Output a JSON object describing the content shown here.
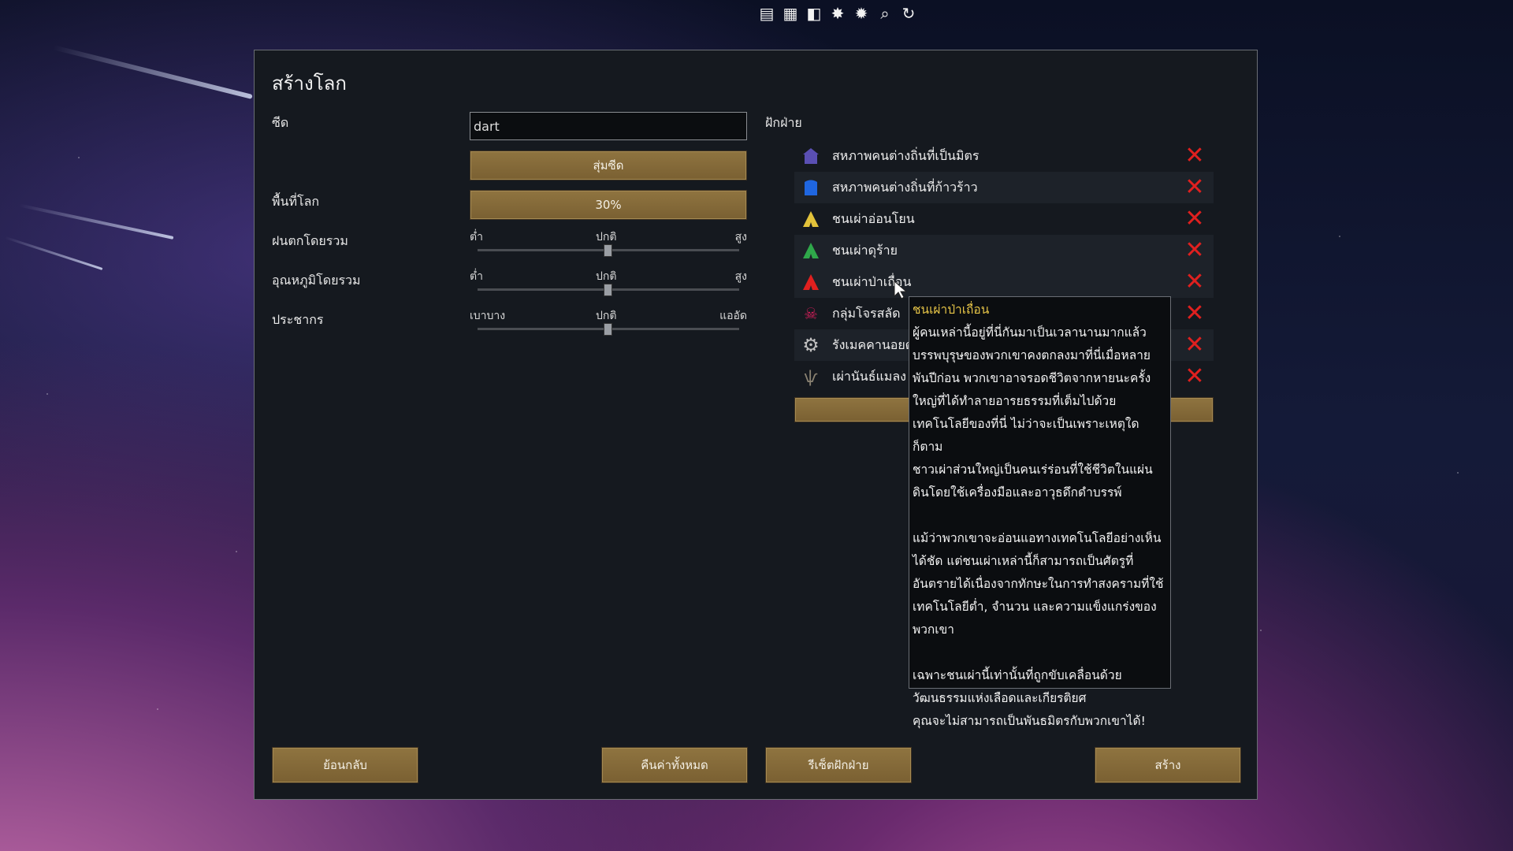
{
  "toolbar": {
    "icons": [
      "list-icon",
      "table-icon",
      "stack-icon",
      "spark-icon",
      "spark-alt-icon",
      "search-icon",
      "refresh-icon"
    ]
  },
  "dialog": {
    "title": "สร้างโลก",
    "seed_label": "ซีด",
    "seed_value": "dart",
    "random_seed_button": "สุ่มซีด",
    "coverage_label": "พื้นที่โลก",
    "coverage_value": "30%",
    "rainfall_label": "ฝนตกโดยรวม",
    "temperature_label": "อุณหภูมิโดยรวม",
    "population_label": "ประชากร",
    "rainfall": {
      "low": "ต่ำ",
      "mid": "ปกติ",
      "high": "สูง"
    },
    "temperature": {
      "low": "ต่ำ",
      "mid": "ปกติ",
      "high": "สูง"
    },
    "population": {
      "low": "เบาบาง",
      "mid": "ปกติ",
      "high": "แออัด"
    }
  },
  "factions": {
    "title": "ฝักฝ่าย",
    "items": [
      {
        "name": "สหภาพคนต่างถิ่นที่เป็นมิตร",
        "icon": "house-icon",
        "color": "#5a4fb3"
      },
      {
        "name": "สหภาพคนต่างถิ่นที่ก้าวร้าว",
        "icon": "house-icon",
        "color": "#1f66e0"
      },
      {
        "name": "ชนเผ่าอ่อนโยน",
        "icon": "tribe-tent-icon",
        "color": "#e2c23a"
      },
      {
        "name": "ชนเผ่าดุร้าย",
        "icon": "tribe-tent-icon",
        "color": "#2fa84a"
      },
      {
        "name": "ชนเผ่าป่าเถื่อน",
        "icon": "tribe-tent-icon",
        "color": "#e0201f"
      },
      {
        "name": "กลุ่มโจรสลัด",
        "icon": "skull-icon",
        "color": "#d21f5a"
      },
      {
        "name": "รังเมคคานอยด์",
        "icon": "gear-icon",
        "color": "#bfbfbf"
      },
      {
        "name": "เผ่านันธ์แมลง",
        "icon": "insect-icon",
        "color": "#8a8272"
      }
    ]
  },
  "tooltip": {
    "title": "ชนเผ่าป่าเถื่อน",
    "p1": "ผู้คนเหล่านี้อยู่ที่นี่กันมาเป็นเวลานานมากแล้ว บรรพบุรุษของพวกเขาคงตกลงมาที่นี่เมื่อหลายพันปีก่อน พวกเขาอาจรอดชีวิตจากหายนะครั้งใหญ่ที่ได้ทำลายอารยธรรมที่เต็มไปด้วยเทคโนโลยีของที่นี่ ไม่ว่าจะเป็นเพราะเหตุใดก็ตาม",
    "p2": "ชาวเผ่าส่วนใหญ่เป็นคนเร่ร่อนที่ใช้ชีวิตในแผ่นดินโดยใช้เครื่องมือและอาวุธดึกดำบรรพ์",
    "p3": "แม้ว่าพวกเขาจะอ่อนแอทางเทคโนโลยีอย่างเห็นได้ชัด แต่ชนเผ่าเหล่านี้ก็สามารถเป็นศัตรูที่อันตรายได้เนื่องจากทักษะในการทำสงครามที่ใช้เทคโนโลยีต่ำ, จำนวน และความแข็งแกร่งของพวกเขา",
    "p4": "เฉพาะชนเผ่านี้เท่านั้นที่ถูกขับเคลื่อนด้วยวัฒนธรรมแห่งเลือดและเกียรติยศ",
    "p5": "คุณจะไม่สามารถเป็นพันธมิตรกับพวกเขาได้!"
  },
  "bottom": {
    "back": "ย้อนกลับ",
    "reset_all": "คืนค่าทั้งหมด",
    "reset_factions": "รีเซ็ตฝักฝ่าย",
    "create": "สร้าง"
  }
}
